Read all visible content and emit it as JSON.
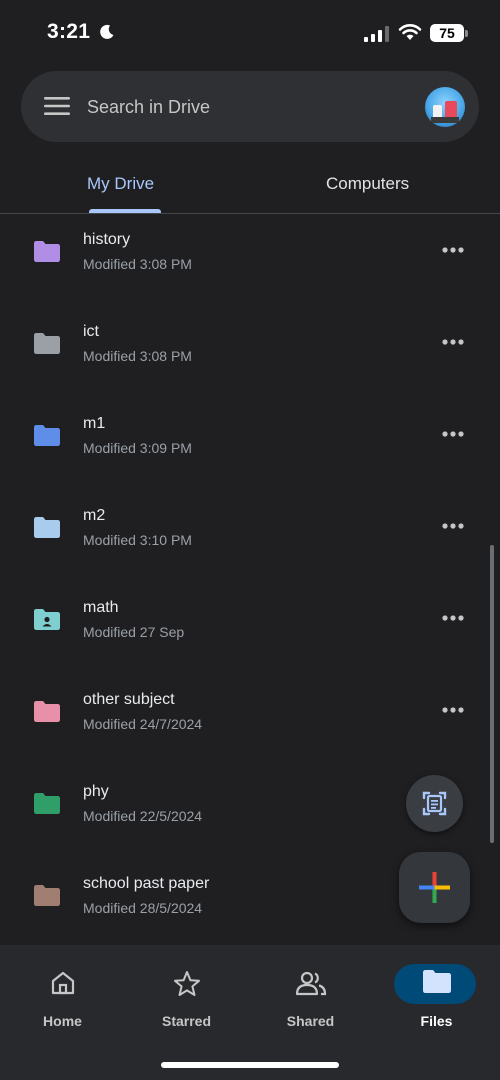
{
  "status_bar": {
    "time": "3:21",
    "battery": "75"
  },
  "search": {
    "placeholder": "Search in Drive"
  },
  "tabs": [
    {
      "label": "My Drive",
      "selected": true
    },
    {
      "label": "Computers",
      "selected": false
    }
  ],
  "files": [
    {
      "name": "history",
      "modified": "Modified 3:08 PM",
      "color": "#b08ee6",
      "icon": "folder-icon"
    },
    {
      "name": "ict",
      "modified": "Modified 3:08 PM",
      "color": "#9aa0a6",
      "icon": "folder-icon"
    },
    {
      "name": "m1",
      "modified": "Modified 3:09 PM",
      "color": "#5f8ee8",
      "icon": "folder-icon"
    },
    {
      "name": "m2",
      "modified": "Modified 3:10 PM",
      "color": "#a9cbee",
      "icon": "folder-icon"
    },
    {
      "name": "math",
      "modified": "Modified 27 Sep",
      "color": "#7fcfd1",
      "icon": "shared-folder-icon"
    },
    {
      "name": "other subject",
      "modified": "Modified 24/7/2024",
      "color": "#e890aa",
      "icon": "folder-icon"
    },
    {
      "name": "phy",
      "modified": "Modified 22/5/2024",
      "color": "#2f9e68",
      "icon": "folder-icon"
    },
    {
      "name": "school past paper",
      "modified": "Modified 28/5/2024",
      "color": "#a07f72",
      "icon": "folder-icon"
    }
  ],
  "nav": [
    {
      "label": "Home",
      "icon": "home-icon"
    },
    {
      "label": "Starred",
      "icon": "star-icon"
    },
    {
      "label": "Shared",
      "icon": "shared-people-icon"
    },
    {
      "label": "Files",
      "icon": "folder-icon",
      "selected": true
    }
  ],
  "colors": {
    "background": "#1f1f22",
    "accent": "#a8c7fa",
    "nav_selected": "#004a77"
  }
}
